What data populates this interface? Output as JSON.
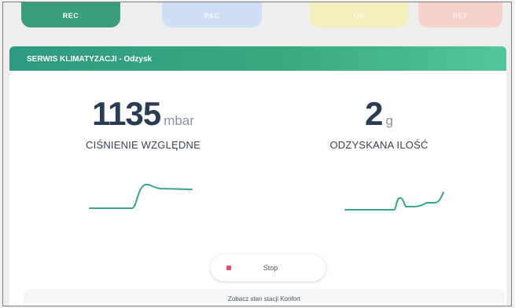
{
  "tabs": [
    {
      "label": "REC",
      "active": true
    },
    {
      "label": "PAC",
      "active": false
    },
    {
      "label": "Oil",
      "active": false
    },
    {
      "label": "REF",
      "active": false
    }
  ],
  "panel": {
    "title": "SERWIS KLIMATYZACJI - Odzysk"
  },
  "metrics": {
    "pressure": {
      "value": "1135",
      "unit": "mbar",
      "label": "CIŚNIENIE WZGLĘDNE"
    },
    "recovered": {
      "value": "2",
      "unit": "g",
      "label": "ODZYSKANA ILOŚĆ"
    }
  },
  "actions": {
    "stop_label": "Stop",
    "status_link": "Zobacz stan stacji Konfort"
  },
  "colors": {
    "accent": "#3a9e7a",
    "graph_line": "#3aa58c",
    "stop_icon": "#e24d72"
  }
}
